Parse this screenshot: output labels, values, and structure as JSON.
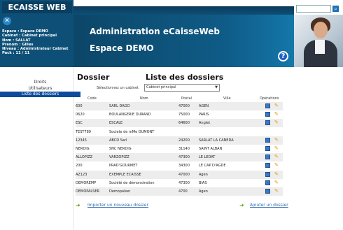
{
  "brand": "ECAISSE WEB",
  "user": {
    "espace": "Espace : Espace DEMO",
    "cabinet": "Cabinet : Cabinet principal",
    "nom": "Nom : SALLAT",
    "prenom": "Prenom : Gilles",
    "niveau": "Niveau : Administrateur Cabinet",
    "pack": "Pack : 11 / 11"
  },
  "nav": [
    {
      "label": "Droits"
    },
    {
      "label": "Utilisateurs"
    },
    {
      "label": "Liste des dossiers",
      "active": true
    }
  ],
  "banner": {
    "title": "Administration eCaisseWeb",
    "subtitle": "Espace DEMO"
  },
  "search": {
    "placeholder": ""
  },
  "section": {
    "left_title": "Dossier",
    "right_title": "Liste des dossiers"
  },
  "selector": {
    "label": "Sélectionnez un cabinet",
    "value": "Cabinet principal"
  },
  "table": {
    "headers": [
      "Code",
      "Nom",
      "Postal",
      "Ville",
      "Opérations"
    ],
    "rows": [
      {
        "code": "600",
        "nom": "SARL DAGO",
        "postal": "47000",
        "ville": "AGEN",
        "has_ops": true
      },
      {
        "code": "0620",
        "nom": "BOULANGERIE DURAND",
        "postal": "75000",
        "ville": "PARIS",
        "has_ops": true
      },
      {
        "code": "ESC",
        "nom": "ESCALE",
        "postal": "64600",
        "ville": "Anglet",
        "has_ops": true
      },
      {
        "code": "TEST789",
        "nom": "Societe de mMe DUMONT",
        "postal": "",
        "ville": "",
        "has_ops": false
      },
      {
        "code": "12345",
        "nom": "ABCD Sarl",
        "postal": "24200",
        "ville": "SARLAT LA CANEDA",
        "has_ops": true
      },
      {
        "code": "NERDIG",
        "nom": "SNC NERDIG",
        "postal": "31140",
        "ville": "SAINT ALBAN",
        "has_ops": true
      },
      {
        "code": "ALLOPIZZ",
        "nom": "VARZOPIZZ",
        "postal": "47300",
        "ville": "LE LEDAT",
        "has_ops": true
      },
      {
        "code": "200",
        "nom": "PRAD'GOURMET",
        "postal": "34300",
        "ville": "LE CAP D'AGDE",
        "has_ops": true
      },
      {
        "code": "AZ123",
        "nom": "EXEMPLE ECAISSE",
        "postal": "47000",
        "ville": "Agen",
        "has_ops": true
      },
      {
        "code": "DEMOREMP",
        "nom": "Société de démonstration",
        "postal": "47300",
        "ville": "BIAS",
        "has_ops": true
      },
      {
        "code": "DEMOPALSER",
        "nom": "Demopalser",
        "postal": "4700",
        "ville": "Agen",
        "has_ops": true
      }
    ]
  },
  "footer": {
    "import_label": "Importer un nouveau dossier",
    "add_label": "Ajouter un dossier"
  },
  "colors": {
    "banner": "#0f5c88",
    "active_nav": "#0e4c9b",
    "link": "#2f6cb3",
    "row_alt": "#ededed"
  }
}
